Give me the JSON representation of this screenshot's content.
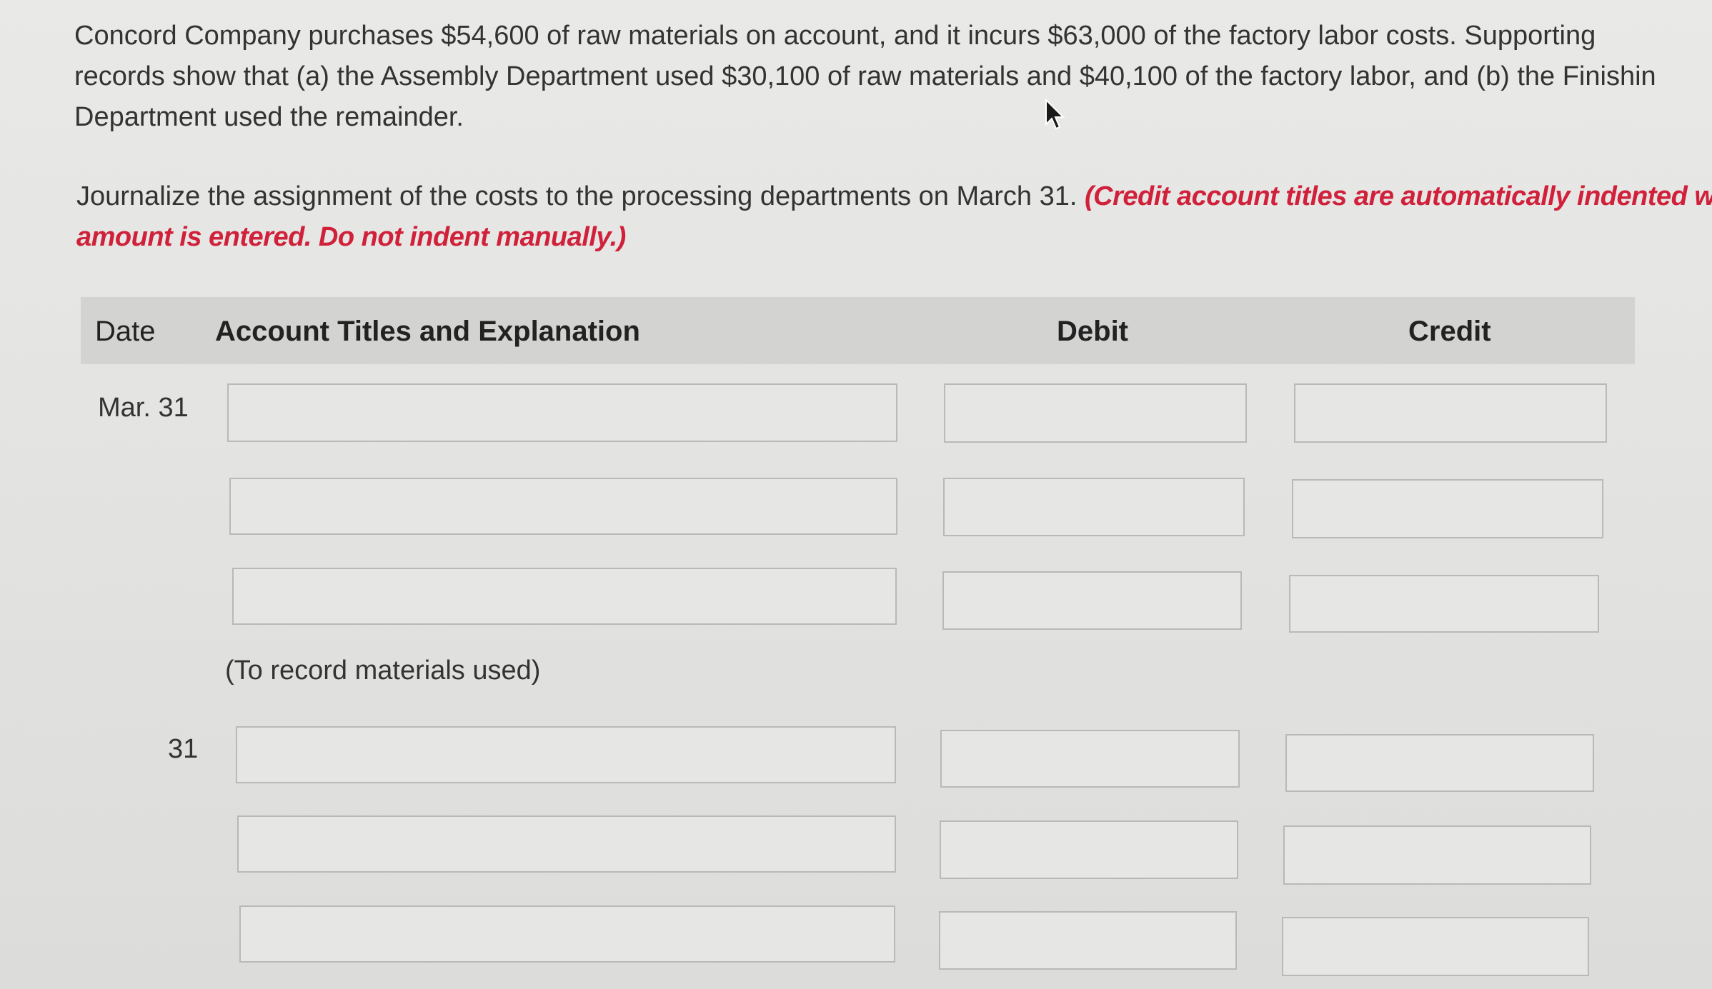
{
  "problem": {
    "line1": "Concord Company purchases $54,600 of raw materials on account, and it incurs $63,000 of the factory labor costs. Supporting",
    "line2": "records show that (a) the Assembly Department used $30,100 of raw materials and $40,100 of the factory labor, and (b) the Finishin",
    "line3": "Department used the remainder."
  },
  "instruction": {
    "text": "Journalize the assignment of the costs to the processing departments on March 31. ",
    "note_line1": "(Credit account titles are automatically indented wh",
    "note_line2": "amount is entered. Do not indent manually.)"
  },
  "table": {
    "headers": {
      "date": "Date",
      "account": "Account Titles and Explanation",
      "debit": "Debit",
      "credit": "Credit"
    },
    "entry1": {
      "date": "Mar. 31",
      "memo": "(To record materials used)"
    },
    "entry2": {
      "date": "31"
    }
  }
}
